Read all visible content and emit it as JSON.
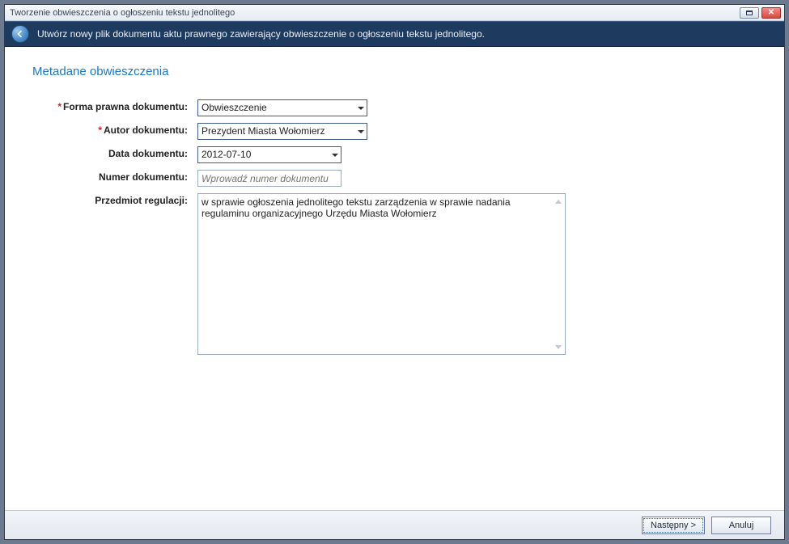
{
  "window": {
    "title": "Tworzenie obwieszczenia o ogłoszeniu tekstu jednolitego"
  },
  "banner": {
    "text": "Utwórz nowy plik dokumentu aktu prawnego zawierający obwieszczenie o ogłoszeniu tekstu jednolitego."
  },
  "section": {
    "header": "Metadane obwieszczenia"
  },
  "form": {
    "forma": {
      "label": "Forma prawna dokumentu:",
      "value": "Obwieszczenie",
      "required": true
    },
    "autor": {
      "label": "Autor dokumentu:",
      "value": "Prezydent Miasta Wołomierz",
      "required": true
    },
    "data": {
      "label": "Data dokumentu:",
      "value": "2012-07-10",
      "required": false
    },
    "numer": {
      "label": "Numer dokumentu:",
      "placeholder": "Wprowadź numer dokumentu",
      "value": "",
      "required": false
    },
    "przedmiot": {
      "label": "Przedmiot regulacji:",
      "value": "w sprawie ogłoszenia jednolitego tekstu zarządzenia w sprawie nadania regulaminu organizacyjnego Urzędu Miasta Wołomierz"
    }
  },
  "footer": {
    "next": "Następny >",
    "cancel": "Anuluj"
  },
  "asterisk": "*"
}
